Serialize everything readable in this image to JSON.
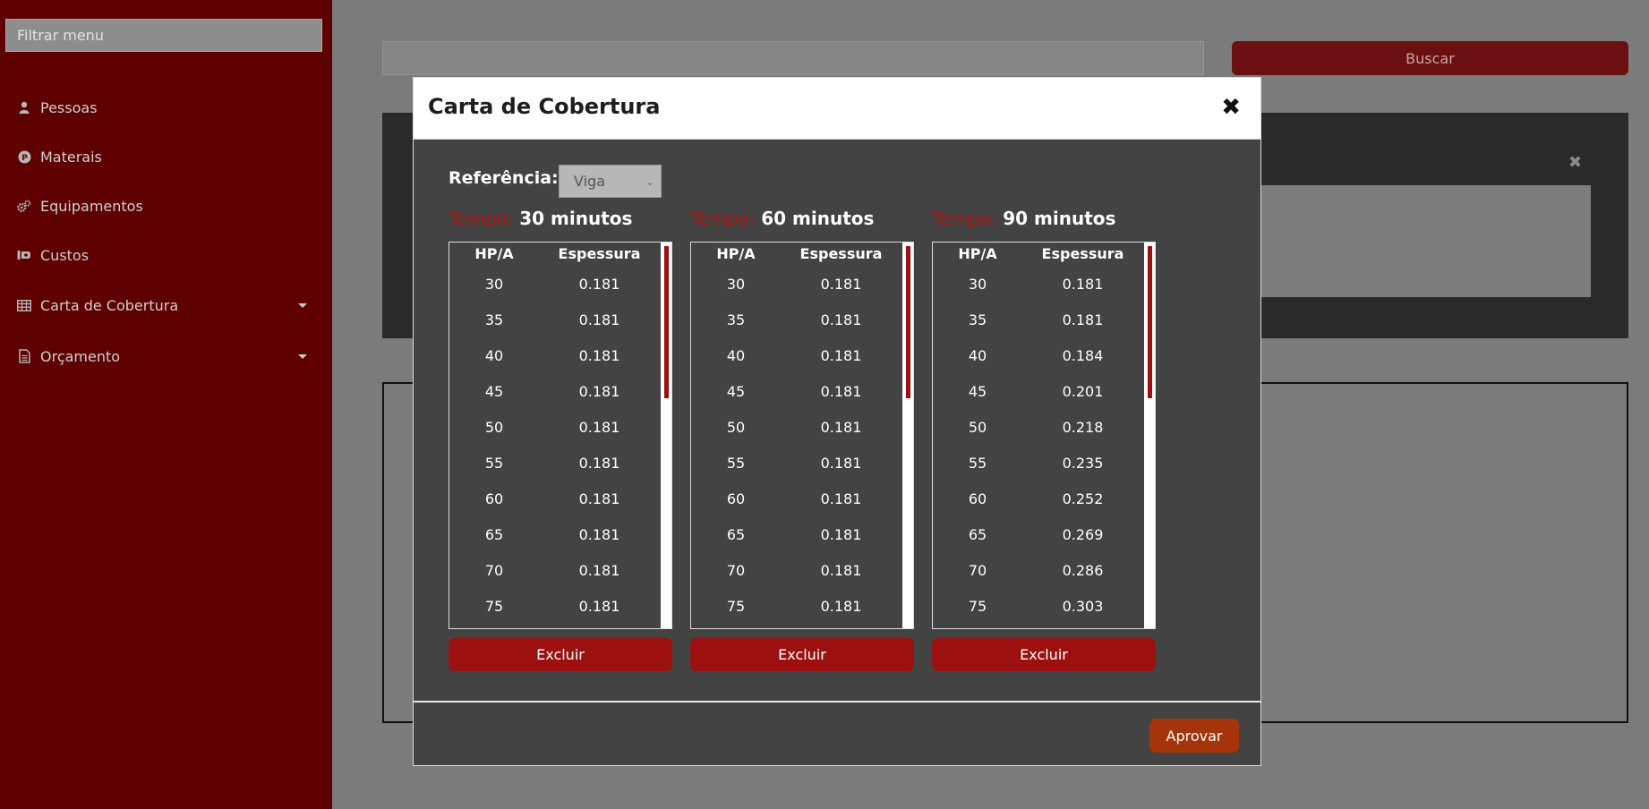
{
  "sidebar": {
    "filter_placeholder": "Filtrar menu",
    "items": [
      {
        "label": "Pessoas",
        "icon": "person-icon"
      },
      {
        "label": "Materais",
        "icon": "coin-icon"
      },
      {
        "label": "Equipamentos",
        "icon": "gears-icon"
      },
      {
        "label": "Custos",
        "icon": "money-hand-icon"
      },
      {
        "label": "Carta de Cobertura",
        "icon": "table-icon",
        "has_caret": true
      },
      {
        "label": "Orçamento",
        "icon": "document-icon",
        "has_caret": true
      }
    ]
  },
  "background": {
    "buscar_label": "Buscar",
    "panel_close": "✖"
  },
  "modal": {
    "title": "Carta de Cobertura",
    "close_glyph": "✖",
    "referencia_label": "Referência:",
    "referencia_value": "Viga",
    "tempo_label": "Tempo:",
    "column_headers": {
      "hp": "HP/A",
      "esp": "Espessura"
    },
    "tables": [
      {
        "tempo": "30 minutos",
        "rows": [
          [
            "30",
            "0.181"
          ],
          [
            "35",
            "0.181"
          ],
          [
            "40",
            "0.181"
          ],
          [
            "45",
            "0.181"
          ],
          [
            "50",
            "0.181"
          ],
          [
            "55",
            "0.181"
          ],
          [
            "60",
            "0.181"
          ],
          [
            "65",
            "0.181"
          ],
          [
            "70",
            "0.181"
          ],
          [
            "75",
            "0.181"
          ]
        ],
        "excluir_label": "Excluir"
      },
      {
        "tempo": "60 minutos",
        "rows": [
          [
            "30",
            "0.181"
          ],
          [
            "35",
            "0.181"
          ],
          [
            "40",
            "0.181"
          ],
          [
            "45",
            "0.181"
          ],
          [
            "50",
            "0.181"
          ],
          [
            "55",
            "0.181"
          ],
          [
            "60",
            "0.181"
          ],
          [
            "65",
            "0.181"
          ],
          [
            "70",
            "0.181"
          ],
          [
            "75",
            "0.181"
          ]
        ],
        "excluir_label": "Excluir"
      },
      {
        "tempo": "90 minutos",
        "rows": [
          [
            "30",
            "0.181"
          ],
          [
            "35",
            "0.181"
          ],
          [
            "40",
            "0.184"
          ],
          [
            "45",
            "0.201"
          ],
          [
            "50",
            "0.218"
          ],
          [
            "55",
            "0.235"
          ],
          [
            "60",
            "0.252"
          ],
          [
            "65",
            "0.269"
          ],
          [
            "70",
            "0.286"
          ],
          [
            "75",
            "0.303"
          ]
        ],
        "excluir_label": "Excluir"
      }
    ],
    "aprovar_label": "Aprovar"
  },
  "colors": {
    "sidebar_bg": "#5e0000",
    "accent_red": "#9c1010",
    "approve_orange": "#a5340a",
    "modal_bg": "#434343"
  }
}
